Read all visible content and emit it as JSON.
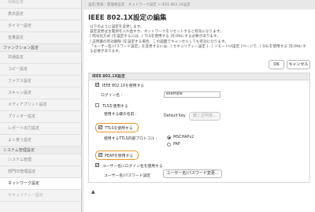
{
  "sidebar": {
    "items": [
      {
        "label": "情報設定",
        "kind": "dim"
      },
      {
        "label": "表示設定",
        "kind": "item"
      },
      {
        "label": "タイマー設定",
        "kind": "item"
      },
      {
        "label": "音量設定",
        "kind": "item"
      },
      {
        "label": "ファンクション設定",
        "kind": "section"
      },
      {
        "label": "共通設定",
        "kind": "item"
      },
      {
        "label": "コピー設定",
        "kind": "item"
      },
      {
        "label": "ファクス設定",
        "kind": "item"
      },
      {
        "label": "スキャン設定",
        "kind": "item"
      },
      {
        "label": "メディアプリント設定",
        "kind": "item"
      },
      {
        "label": "プリンター設定",
        "kind": "item"
      },
      {
        "label": "レポート出力設定",
        "kind": "item"
      },
      {
        "label": "よく使う設定",
        "kind": "item"
      },
      {
        "label": "システム管理設定",
        "kind": "section"
      },
      {
        "label": "システム管理",
        "kind": "item"
      },
      {
        "label": "部門ID管理設定",
        "kind": "item"
      },
      {
        "label": "ネットワーク設定",
        "kind": "active"
      },
      {
        "label": "セキュリティー設定",
        "kind": "dim"
      }
    ]
  },
  "breadcrumb": "設定/登録 : 管理者設定 : ネットワーク設定 > IEEE 802.1X設定",
  "page": {
    "title": "IEEE 802.1X設定の編集",
    "description": [
      "以下のように設定を変更します。",
      "設定変更は主電源を入れ直すか、ネットワークをリセットすると有効になります。",
      "[ 暗号化方式 ]を設定するには、[ TLSを使用する ]をONにする必要があります。",
      "[ 証明書の有効期限 ]を設定する場合、この画面でキャンセルしても有効になります。",
      "「ユーザー名/パスワード設定」を変更するには、[ セキュリティー設定 ] - [ リモートUI設定 ]ページで、[ SSLを使用する ]をONにする必要があります。"
    ],
    "ok_label": "OK",
    "cancel_label": "キャンセル"
  },
  "section": {
    "heading": "IEEE 802.1X設定",
    "use_ieee_label": "IEEE 802.1Xを使用する",
    "use_ieee_checked": true,
    "login_name_label": "ログイン名 :",
    "login_name_value": "example",
    "tls_label": "TLSを使用する",
    "tls_checked": false,
    "key_cert_label": "使用する鍵の名前 :",
    "default_key_label": "Default Key",
    "key_button_label": "鍵と証明書...",
    "ttls_label": "TTLSを使用する",
    "ttls_checked": true,
    "ttls_protocol_label": "使用するTTLS内部プロトコル :",
    "mschap_label": "MSCHAPv2",
    "mschap_checked": true,
    "pap_label": "PAP",
    "pap_checked": false,
    "peap_label": "PEAPを使用する",
    "peap_checked": true,
    "user_login_same_label": "ユーザー名にログイン名を使用する",
    "user_login_same_checked": true,
    "userpass_setting_label": "ユーザー名/パスワード設定",
    "userpass_button_label": "ユーザー名/パスワード変更..."
  },
  "footer": {
    "mark": "▲"
  },
  "colors": {
    "highlight": "#e5962b",
    "active_sidebar": "#ffffff"
  }
}
